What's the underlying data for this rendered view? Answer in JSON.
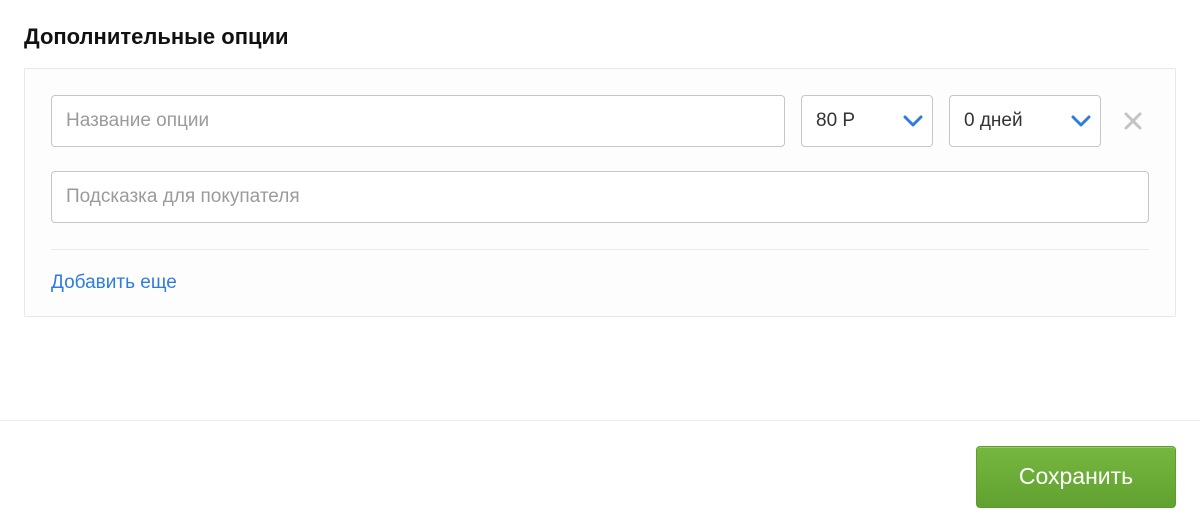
{
  "section_title": "Дополнительные опции",
  "option": {
    "name_placeholder": "Название опции",
    "price_value": "80 Р",
    "duration_value": "0 дней",
    "hint_placeholder": "Подсказка для покупателя"
  },
  "add_more_label": "Добавить еще",
  "save_label": "Сохранить",
  "icons": {
    "chevron": "chevron-down",
    "close": "close"
  },
  "colors": {
    "accent_blue": "#2f7ce0",
    "save_green": "#68aa38"
  }
}
